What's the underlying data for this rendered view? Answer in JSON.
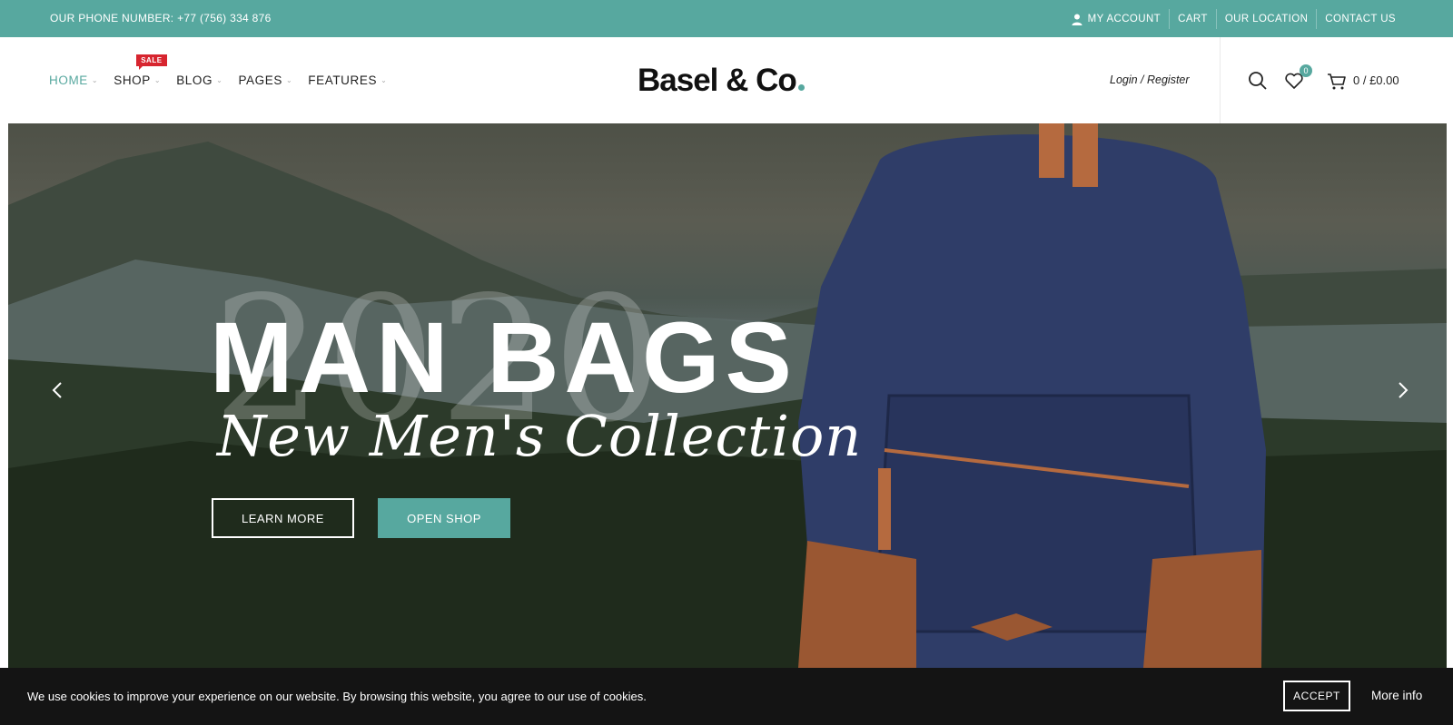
{
  "topbar": {
    "phone": "OUR PHONE NUMBER: +77 (756) 334 876",
    "links": [
      "MY ACCOUNT",
      "CART",
      "OUR LOCATION",
      "CONTACT US"
    ]
  },
  "nav": {
    "items": [
      {
        "label": "HOME",
        "active": true
      },
      {
        "label": "SHOP",
        "badge": "SALE"
      },
      {
        "label": "BLOG"
      },
      {
        "label": "PAGES"
      },
      {
        "label": "FEATURES"
      }
    ]
  },
  "header": {
    "logo": "Basel & Co",
    "login": "Login / Register",
    "wishlist_count": "0",
    "cart_summary": "0 / £0.00",
    "icons": [
      "search-icon",
      "heart-icon",
      "cart-icon",
      "user-icon"
    ]
  },
  "hero": {
    "year": "2020",
    "title": "MAN BAGS",
    "subtitle": "New Men's Collection",
    "learn_more": "LEARN MORE",
    "open_shop": "OPEN SHOP"
  },
  "cookie": {
    "message": "We use cookies to improve your experience on our website. By browsing this website, you agree to our use of cookies.",
    "accept": "ACCEPT",
    "more_info": "More info"
  },
  "colors": {
    "accent": "#57a89f",
    "sale": "#d7252f",
    "cookie_bg": "#141414"
  }
}
